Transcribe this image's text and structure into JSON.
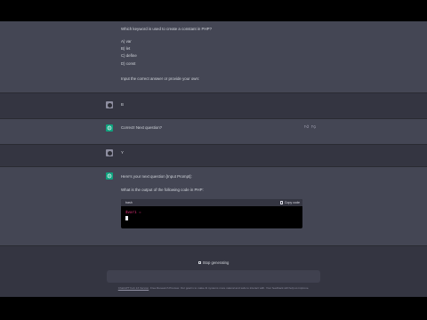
{
  "conversation": {
    "question_msg": {
      "intro": "Which keyword is used to create a constant in PHP?",
      "options": [
        "A) var",
        "B) let",
        "C) define",
        "D) const"
      ],
      "instruction": "Input the correct answer or provide your own:"
    },
    "user_msg_1": "B",
    "assistant_msg_1": "Correct! Next question?",
    "user_msg_2": "Y",
    "assistant_msg_2": {
      "line1": "Here's your next question [Input Prompt]:",
      "line2": "What is the output of the following code in PHP:"
    },
    "code_block": {
      "language": "bash",
      "copy_label": "Copy code",
      "code": "$var1 = "
    }
  },
  "controls": {
    "stop_label": "Stop generating",
    "stop_icon": "stop-square-icon"
  },
  "footer": {
    "link_text": "ChatGPT Feb 13 Version",
    "text": ". Free Research Preview. Our goal is to make AI systems more natural and safe to interact with. Your feedback will help us improve."
  },
  "colors": {
    "background": "#343541",
    "assistant_bg": "#444654",
    "accent": "#10a37f",
    "keyword": "#df3079"
  }
}
